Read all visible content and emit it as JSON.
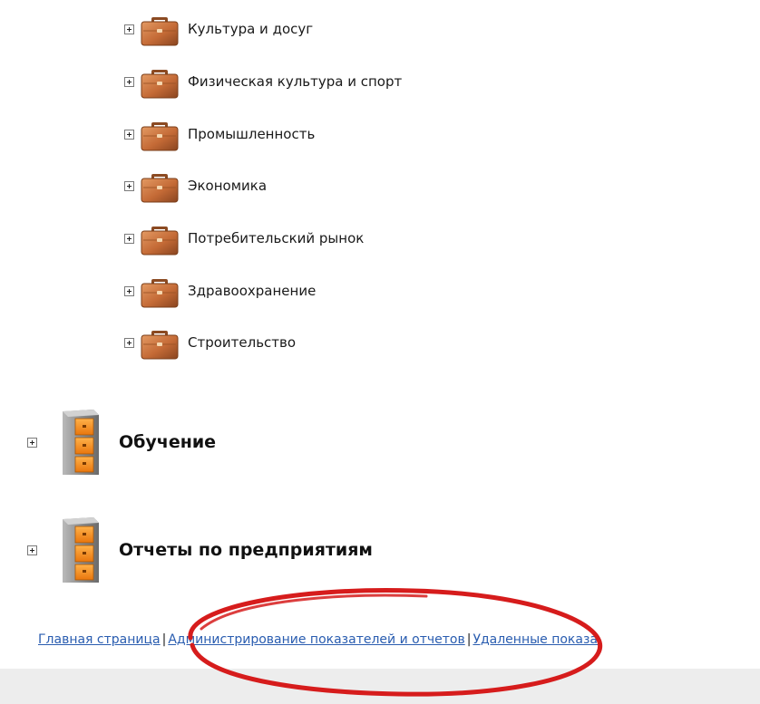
{
  "subcategories": [
    {
      "label": "Культура и досуг"
    },
    {
      "label": "Физическая культура и спорт"
    },
    {
      "label": "Промышленность"
    },
    {
      "label": "Экономика"
    },
    {
      "label": "Потребительский рынок"
    },
    {
      "label": "Здравоохранение"
    },
    {
      "label": "Строительство"
    }
  ],
  "sections": [
    {
      "label": "Обучение"
    },
    {
      "label": "Отчеты по предприятиям"
    }
  ],
  "footer": {
    "home": "Главная страница",
    "separator": "|",
    "admin": "Администрирование показателей и отчетов",
    "deleted": "Удаленные показа"
  },
  "colors": {
    "link": "#2a5db0",
    "annotation": "#d61c1c",
    "briefcase": "#c8703c",
    "cabinet_drawer": "#f2891c"
  },
  "icons": {
    "subcategory": "briefcase-icon",
    "section": "file-cabinet-icon",
    "expander": "plus-box-icon"
  }
}
